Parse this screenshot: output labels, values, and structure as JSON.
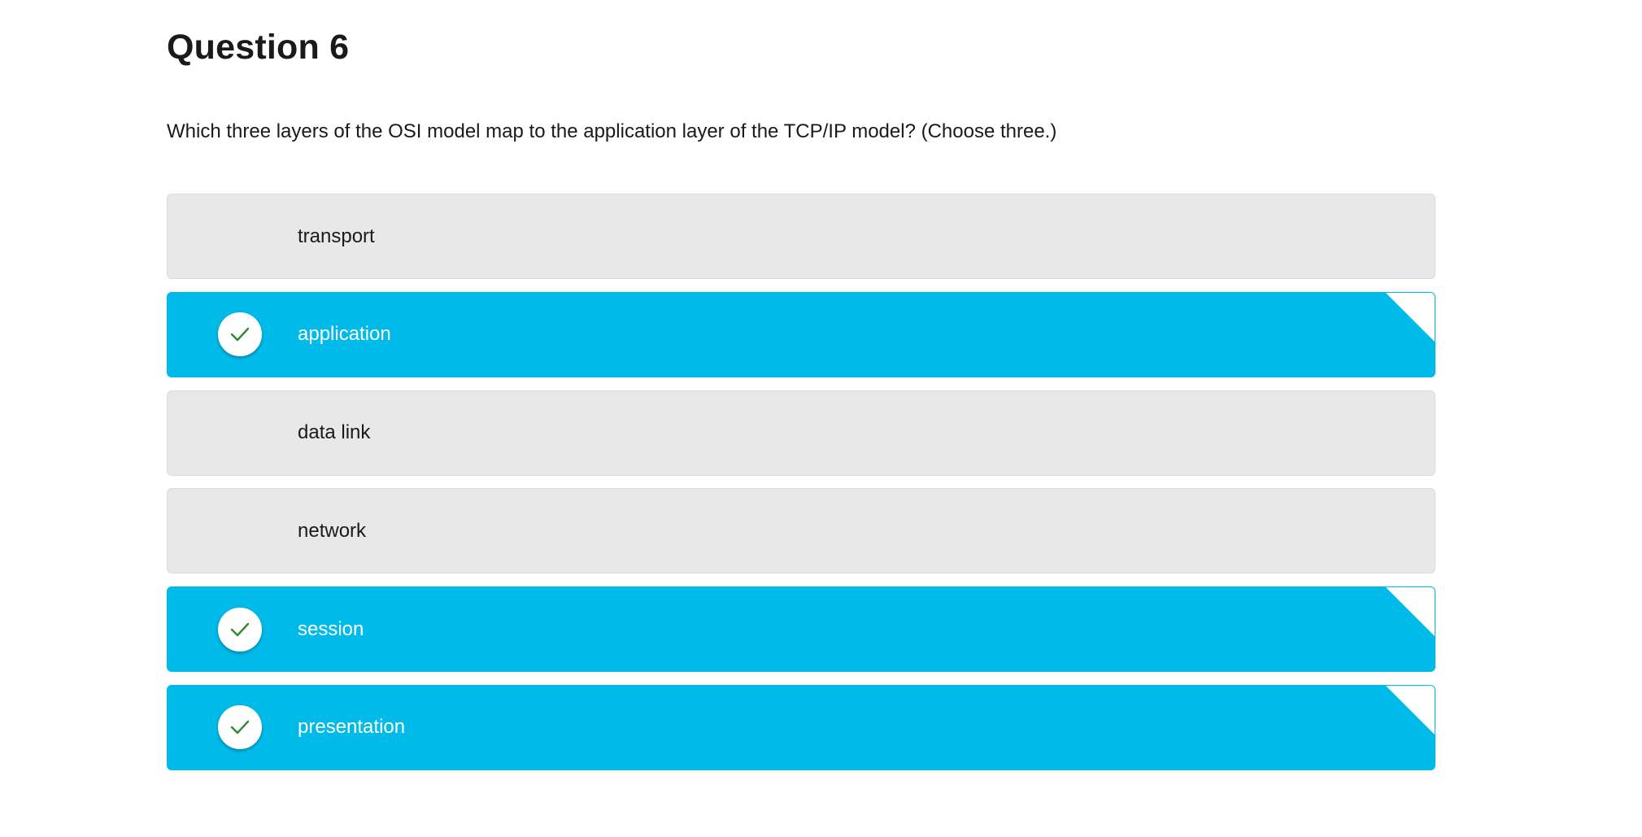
{
  "question": {
    "title": "Question 6",
    "prompt": "Which three layers of the OSI model map to the application layer of the TCP/IP model? (Choose three.)"
  },
  "options": [
    {
      "label": "transport",
      "selected": false
    },
    {
      "label": "application",
      "selected": true
    },
    {
      "label": "data link",
      "selected": false
    },
    {
      "label": "network",
      "selected": false
    },
    {
      "label": "session",
      "selected": true
    },
    {
      "label": "presentation",
      "selected": true
    }
  ],
  "colors": {
    "selected_background": "#00bbea",
    "unselected_background": "#e8e8e8",
    "check_color": "#2e8b2e"
  },
  "icons": {
    "selected_marker": "checkmark-icon",
    "corner": "corner-fold-icon"
  }
}
